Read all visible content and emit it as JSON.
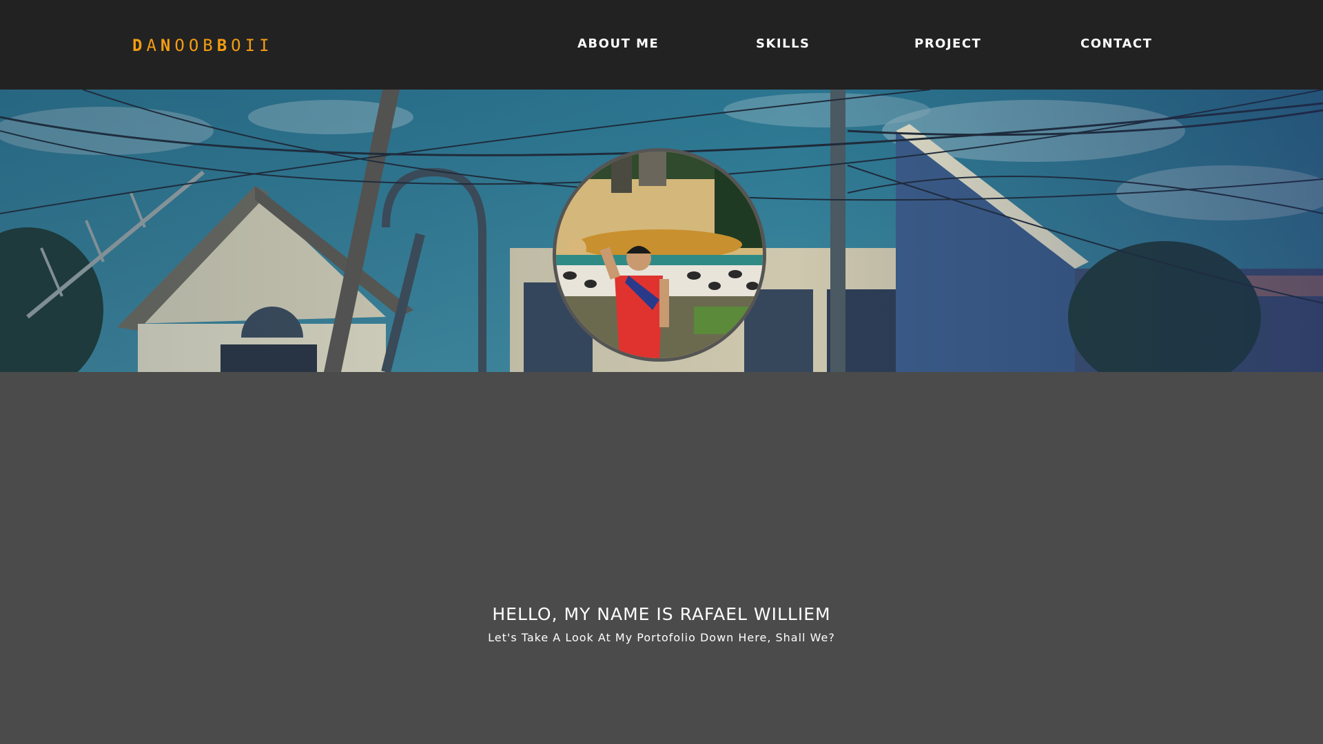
{
  "navbar": {
    "logo": {
      "letters": [
        {
          "char": "D",
          "bold": true
        },
        {
          "char": "A",
          "bold": false
        },
        {
          "char": "N",
          "bold": true
        },
        {
          "char": "O",
          "bold": false
        },
        {
          "char": "O",
          "bold": false
        },
        {
          "char": "B",
          "bold": false
        },
        {
          "char": "B",
          "bold": true
        },
        {
          "char": "O",
          "bold": false
        },
        {
          "char": "I",
          "bold": false
        },
        {
          "char": "I",
          "bold": false
        }
      ],
      "color": "#f39c12"
    },
    "links": [
      {
        "label": "ABOUT ME"
      },
      {
        "label": "SKILLS"
      },
      {
        "label": "PROJECT"
      },
      {
        "label": "CONTACT"
      }
    ],
    "background": "#222222"
  },
  "hero": {
    "background_tint": "#2f6f86",
    "profile_photo": "profile-photo"
  },
  "intro": {
    "greeting": "HELLO, MY NAME IS RAFAEL WILLIEM",
    "tagline": "Let's Take A Look At My Portofolio Down Here, Shall We?"
  },
  "page": {
    "background": "#4b4b4b"
  }
}
